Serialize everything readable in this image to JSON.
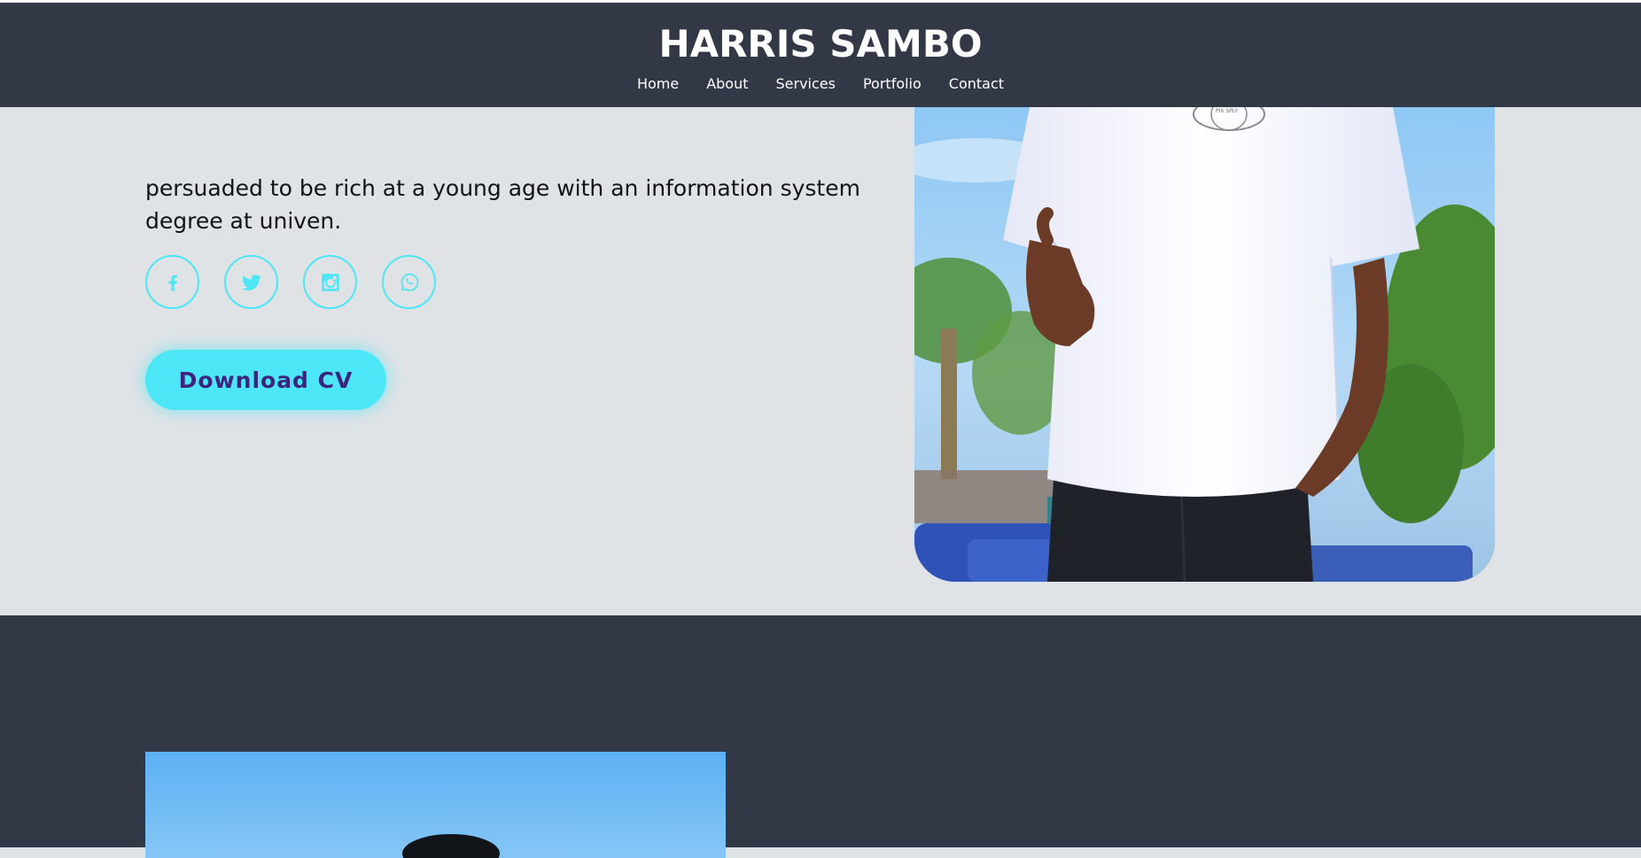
{
  "header": {
    "title": "HARRIS SAMBO",
    "nav": [
      "Home",
      "About",
      "Services",
      "Portfolio",
      "Contact"
    ]
  },
  "hero": {
    "text": "persuaded to be rich at a young age with an information system degree at univen.",
    "socials": [
      "facebook-icon",
      "twitter-icon",
      "instagram-icon",
      "whatsapp-icon"
    ],
    "cv_button": "Download CV",
    "shirt_print": "PIX SPLY"
  },
  "colors": {
    "header_bg": "#323846",
    "hero_bg": "#dfe3e6",
    "accent": "#4de6f7",
    "button_text": "#3c2580"
  }
}
